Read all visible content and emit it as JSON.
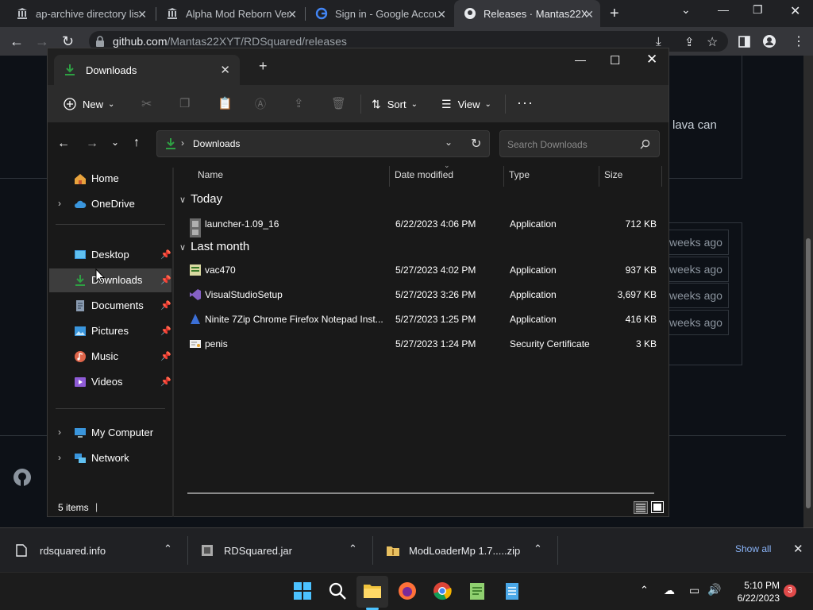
{
  "browser": {
    "tabs": [
      {
        "label": "ap-archive directory lis",
        "icon": "archive-icon"
      },
      {
        "label": "Alpha Mod Reborn Ver",
        "icon": "archive-icon"
      },
      {
        "label": "Sign in - Google Accou",
        "icon": "google-icon"
      },
      {
        "label": "Releases · Mantas22XY",
        "icon": "github-icon"
      }
    ],
    "url_host": "github.com",
    "url_path": "/Mantas22XYT/RDSquared/releases"
  },
  "background_page": {
    "text_snippet": "lava can",
    "release_times": [
      "weeks ago",
      "weeks ago",
      "weeks ago",
      "weeks ago"
    ]
  },
  "explorer": {
    "tab_title": "Downloads",
    "commands": {
      "new": "New",
      "sort": "Sort",
      "view": "View"
    },
    "breadcrumb": "Downloads",
    "search_placeholder": "Search Downloads",
    "nav": {
      "home": "Home",
      "onedrive": "OneDrive",
      "desktop": "Desktop",
      "downloads": "Downloads",
      "documents": "Documents",
      "pictures": "Pictures",
      "music": "Music",
      "videos": "Videos",
      "mycomputer": "My Computer",
      "network": "Network"
    },
    "columns": {
      "name": "Name",
      "date": "Date modified",
      "type": "Type",
      "size": "Size"
    },
    "groups": {
      "today": "Today",
      "lastmonth": "Last month"
    },
    "files": [
      {
        "name": "launcher-1.09_16",
        "date": "6/22/2023 4:06 PM",
        "type": "Application",
        "size": "712 KB"
      },
      {
        "name": "vac470",
        "date": "5/27/2023 4:02 PM",
        "type": "Application",
        "size": "937 KB"
      },
      {
        "name": "VisualStudioSetup",
        "date": "5/27/2023 3:26 PM",
        "type": "Application",
        "size": "3,697 KB"
      },
      {
        "name": "Ninite 7Zip Chrome Firefox Notepad Inst...",
        "date": "5/27/2023 1:25 PM",
        "type": "Application",
        "size": "416 KB"
      },
      {
        "name": "penis",
        "date": "5/27/2023 1:24 PM",
        "type": "Security Certificate",
        "size": "3 KB"
      }
    ],
    "status": "5 items"
  },
  "downloads_bar": {
    "items": [
      "rdsquared.info",
      "RDSquared.jar",
      "ModLoaderMp 1.7.....zip"
    ],
    "show_all": "Show all"
  },
  "taskbar": {
    "time": "5:10 PM",
    "date": "6/22/2023",
    "notification_count": "3"
  },
  "colors": {
    "accent": "#0078d4",
    "download_green": "#2ea043",
    "link_blue": "#8ab4f8"
  }
}
